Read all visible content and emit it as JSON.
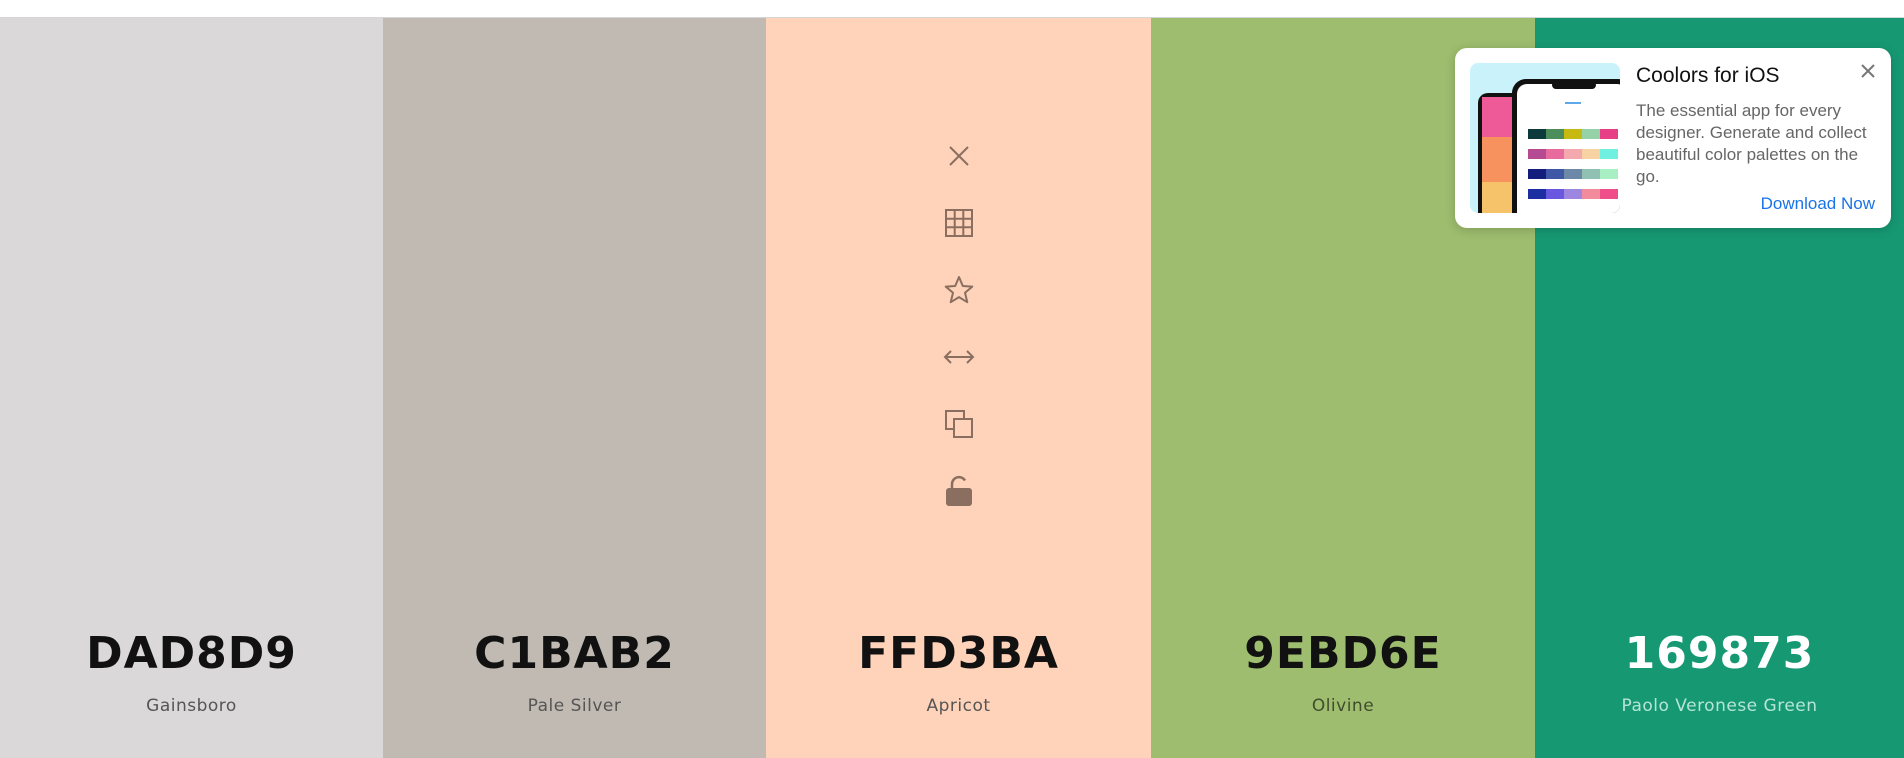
{
  "palette": {
    "swatches": [
      {
        "hex": "DAD8D9",
        "name": "Gainsboro",
        "bg": "#DAD8D9",
        "hex_color": "#111111",
        "name_color": "#555555"
      },
      {
        "hex": "C1BAB2",
        "name": "Pale Silver",
        "bg": "#C1BAB2",
        "hex_color": "#111111",
        "name_color": "#555555"
      },
      {
        "hex": "FFD3BA",
        "name": "Apricot",
        "bg": "#FFD3BA",
        "hex_color": "#111111",
        "name_color": "#555555"
      },
      {
        "hex": "9EBD6E",
        "name": "Olivine",
        "bg": "#9EBD6E",
        "hex_color": "#111111",
        "name_color": "#3f4d2d"
      },
      {
        "hex": "169873",
        "name": "Paolo Veronese Green",
        "bg": "#169873",
        "hex_color": "#ffffff",
        "name_color": "#b7e5d5"
      }
    ],
    "toolbar_icons": [
      "close-icon",
      "grid-icon",
      "star-icon",
      "resize-arrows-icon",
      "copy-icon",
      "unlock-icon"
    ],
    "icon_color": "#8a6f60"
  },
  "promo": {
    "title": "Coolors for iOS",
    "description": "The essential app for every designer. Generate and collect beautiful color palettes on the go.",
    "link": "Download Now",
    "link_color": "#1a73e8"
  }
}
